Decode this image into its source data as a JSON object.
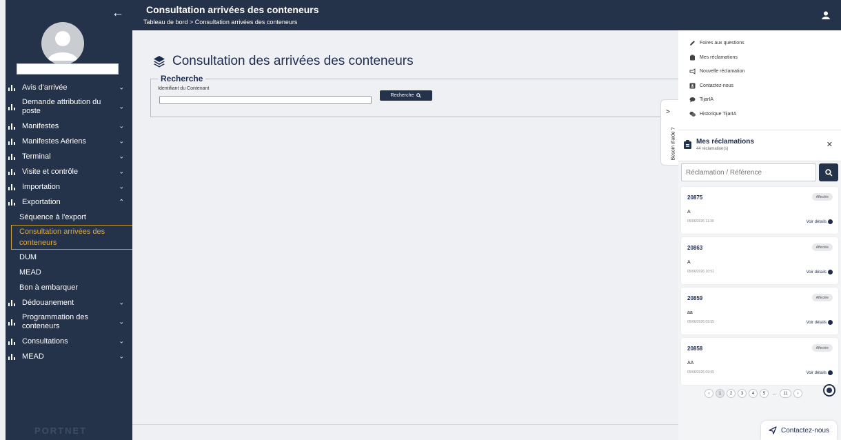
{
  "colors": {
    "primary": "#24324a",
    "accent": "#e0a93a",
    "heading": "#1d2b4f"
  },
  "header": {
    "title": "Consultation arrivées des conteneurs",
    "breadcrumb": "Tableau de bord > Consultation arrivées des conteneurs",
    "user_icon": "user-icon"
  },
  "sidebar": {
    "items": [
      {
        "label": "Avis d'arrivée",
        "icon": "bar-chart-icon",
        "chevron": "down"
      },
      {
        "label": "Demande attribution du poste",
        "icon": "bar-chart-icon",
        "chevron": "down"
      },
      {
        "label": "Manifestes",
        "icon": "bar-chart-icon",
        "chevron": "down"
      },
      {
        "label": "Manifestes Aériens",
        "icon": "bar-chart-icon",
        "chevron": "down"
      },
      {
        "label": "Terminal",
        "icon": "bar-chart-icon",
        "chevron": "down"
      },
      {
        "label": "Visite et contrôle",
        "icon": "bar-chart-icon",
        "chevron": "down"
      },
      {
        "label": "Importation",
        "icon": "bar-chart-icon",
        "chevron": "down"
      },
      {
        "label": "Exportation",
        "icon": "bar-chart-icon",
        "chevron": "up"
      }
    ],
    "sub_items": [
      {
        "label": "Séquence à l'export",
        "active": false
      },
      {
        "label": "Consultation arrivées des conteneurs",
        "active": true
      },
      {
        "label": "DUM",
        "active": false
      },
      {
        "label": "MEAD",
        "active": false
      },
      {
        "label": "Bon à embarquer",
        "active": false
      }
    ],
    "items_after": [
      {
        "label": "Dédouanement",
        "icon": "bar-chart-icon",
        "chevron": "down"
      },
      {
        "label": "Programmation des conteneurs",
        "icon": "bar-chart-icon",
        "chevron": "down"
      },
      {
        "label": "Consultations",
        "icon": "bar-chart-icon",
        "chevron": "down"
      },
      {
        "label": "MEAD",
        "icon": "bar-chart-icon",
        "chevron": "down"
      }
    ],
    "footer_logo": "PORTNET"
  },
  "main": {
    "page_title": "Consultation des arrivées des conteneurs",
    "search_section": "Recherche",
    "field_label": "Identifiant du Contenant",
    "field_value": "",
    "search_button": "Recherche"
  },
  "help_tab": {
    "label": "Besoin d'aide ?"
  },
  "help_menu": [
    {
      "label": "Foires aux questions",
      "icon": "pencil-icon"
    },
    {
      "label": "Mes réclamations",
      "icon": "clipboard-icon"
    },
    {
      "label": "Nouvelle réclamation",
      "icon": "megaphone-icon"
    },
    {
      "label": "Contactez-nous",
      "icon": "contact-card-icon"
    },
    {
      "label": "TijarIA",
      "icon": "chat-icon"
    },
    {
      "label": "Historique TijarIA",
      "icon": "chat-history-icon"
    }
  ],
  "reclamations": {
    "title": "Mes réclamations",
    "count": "44 réclamation(s)",
    "search_placeholder": "Réclamation / Référence",
    "cards": [
      {
        "ref": "20875",
        "status": "Affectée",
        "text": "A",
        "date": "05/06/2026 11:39",
        "details": "Voir détails"
      },
      {
        "ref": "20863",
        "status": "Affectée",
        "text": "A",
        "date": "05/06/2026 10:51",
        "details": "Voir détails"
      },
      {
        "ref": "20859",
        "status": "Affectée",
        "text": "aa",
        "date": "05/06/2026 09:55",
        "details": "Voir détails"
      },
      {
        "ref": "20858",
        "status": "Affectée",
        "text": "AA",
        "date": "05/06/2026 09:55",
        "details": "Voir détails"
      }
    ],
    "pagination": {
      "prev": "‹",
      "pages": [
        "1",
        "2",
        "3",
        "4",
        "5"
      ],
      "ellipsis": "...",
      "last": "11",
      "next": "›",
      "current": "1"
    }
  },
  "contact_button": "Contactez-nous"
}
